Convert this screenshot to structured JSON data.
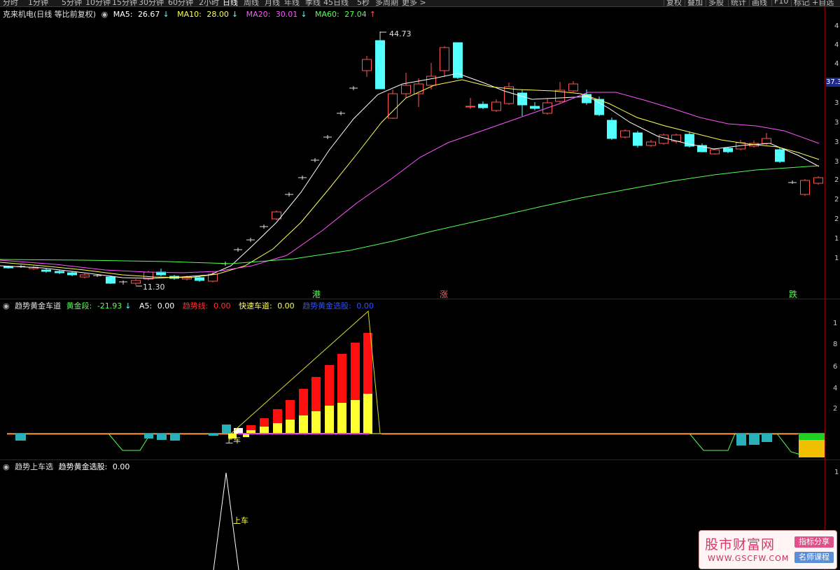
{
  "toolbar": {
    "periods": [
      "分时",
      "1分钟",
      "5分钟",
      "10分钟",
      "15分钟",
      "30分钟",
      "60分钟",
      "2小时",
      "日线",
      "周线",
      "月线",
      "年线",
      "季线",
      "45日线",
      "5秒",
      "多周期",
      "更多 >"
    ],
    "active_index": 8,
    "right_tools": [
      "复权",
      "叠加",
      "多股",
      "统计",
      "画线",
      "F10",
      "标记",
      "+自选"
    ]
  },
  "main_panel": {
    "title": "克来机电(日线 等比前复权)",
    "ma5": {
      "label": "MA5:",
      "value": "26.67",
      "arrow": "↓",
      "color": "#ffffff"
    },
    "ma10": {
      "label": "MA10:",
      "value": "28.00",
      "arrow": "↓",
      "color": "#ffff54"
    },
    "ma20": {
      "label": "MA20:",
      "value": "30.01",
      "arrow": "↓",
      "color": "#ff54ff"
    },
    "ma60": {
      "label": "MA60:",
      "value": "27.04",
      "arrow": "↑",
      "color": "#54ff54"
    },
    "high_label": "44.73",
    "low_label": "11.30",
    "markers": [
      {
        "text": "港",
        "color": "#54ff54"
      },
      {
        "text": "涨",
        "color": "#ff5454"
      },
      {
        "text": "跌",
        "color": "#54ff54"
      }
    ],
    "price_tag": "37.3",
    "axis_ticks": [
      "4",
      "4",
      "4",
      "3",
      "3",
      "3",
      "3",
      "2",
      "2",
      "2",
      "1",
      "1"
    ]
  },
  "indicator1": {
    "name": "趋势黄金车道",
    "gold": {
      "label": "黄金段:",
      "value": "-21.93",
      "arrow": "↓",
      "color": "#54ff54"
    },
    "a5": {
      "label": "A5:",
      "value": "0.00",
      "color": "#ffffff"
    },
    "trend": {
      "label": "趋势线:",
      "value": "0.00",
      "color": "#ff3030"
    },
    "fast": {
      "label": "快速车道:",
      "value": "0.00",
      "color": "#ffff54"
    },
    "pick": {
      "label": "趋势黄金选股:",
      "value": "0.00",
      "color": "#3050ff"
    },
    "signal_label": "上车",
    "axis_ticks": [
      "1",
      "8",
      "6",
      "4",
      "2"
    ]
  },
  "indicator2": {
    "name": "趋势上车选",
    "pick": {
      "label": "趋势黄金选股:",
      "value": "0.00",
      "color": "#ffffff"
    },
    "signal_label": "上车",
    "axis_ticks": [
      "1"
    ]
  },
  "watermark": {
    "title": "股市财富网",
    "url": "WWW.GSCFW.COM",
    "badge1": "指标分享",
    "badge2": "名师课程"
  },
  "colors": {
    "up": "#ff5454",
    "down": "#54ffff",
    "frame": "#8b0000"
  }
}
